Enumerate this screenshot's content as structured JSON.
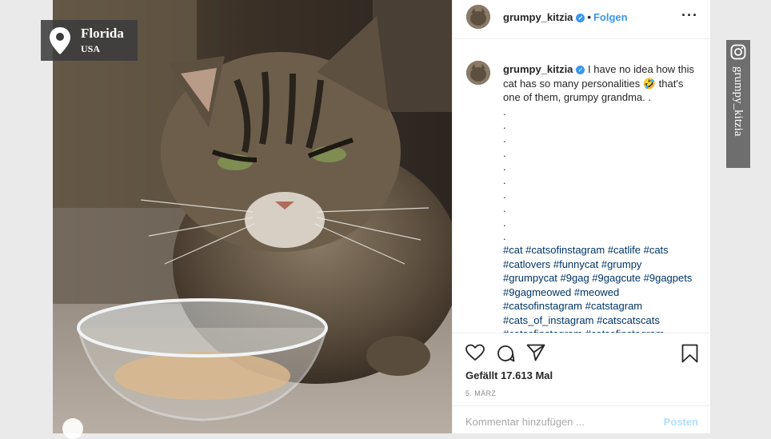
{
  "location": {
    "city": "Florida",
    "country": "USA"
  },
  "post": {
    "username": "grumpy_kitzia",
    "verified_mark": "✓",
    "separator": "•",
    "follow_label": "Folgen",
    "more_label": "···",
    "caption_text": "I have no idea how this cat has so many personalities 🤣 that's one of them, grumpy grandma. .",
    "caption_dots": [
      ".",
      ".",
      ".",
      ".",
      ".",
      ".",
      ".",
      ".",
      ".",
      "."
    ],
    "hashtags": "#cat #catsofinstagram #catlife #cats #catlovers #funnycat #grumpy #grumpycat #9gag #9gagcute #9gagpets #9gagmeowed #meowed #catsofinstagram #catstagram #cats_of_instagram #catscatscats #catsofinstagram #catsofinstagram",
    "likes": "Gefällt 17.613 Mal",
    "date": "5. MÄRZ",
    "comment_placeholder": "Kommentar hinzufügen ...",
    "post_button": "Posten"
  },
  "watermark": {
    "handle": "grumpy_kitzia",
    "icon": "instagram-icon"
  },
  "colors": {
    "link": "#3897f0",
    "hashtag": "#003569",
    "badge": "#3c3c3c",
    "watermark": "#6e6e6e"
  }
}
